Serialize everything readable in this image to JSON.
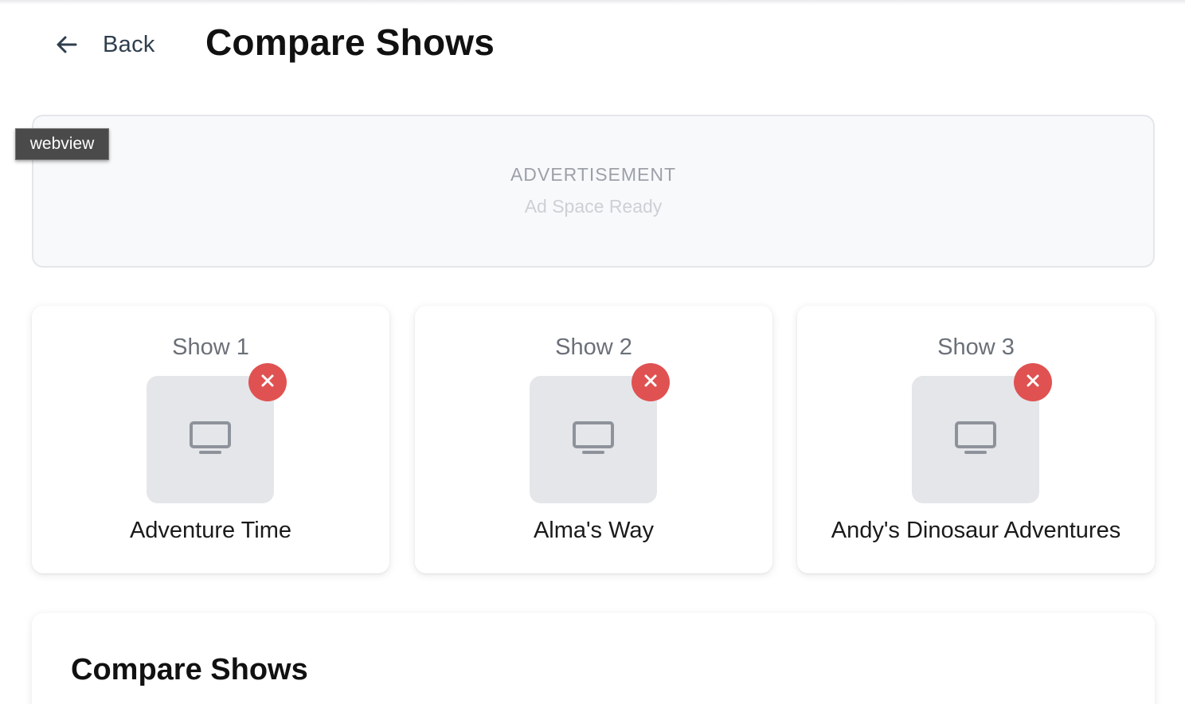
{
  "header": {
    "back_label": "Back",
    "title": "Compare Shows"
  },
  "ad": {
    "heading": "ADVERTISEMENT",
    "subtext": "Ad Space Ready"
  },
  "overlay_tag": "webview",
  "shows": [
    {
      "slot": "Show 1",
      "name": "Adventure Time"
    },
    {
      "slot": "Show 2",
      "name": "Alma's Way"
    },
    {
      "slot": "Show 3",
      "name": "Andy's Dinosaur Adventures"
    }
  ],
  "compare_section": {
    "title": "Compare Shows"
  },
  "icons": {
    "back": "arrow-left-icon",
    "thumbnail": "tv-icon",
    "remove": "close-icon"
  },
  "colors": {
    "remove_button": "#e05252",
    "thumbnail_bg": "#e5e6ea",
    "ad_bg": "#f8f9fb"
  }
}
